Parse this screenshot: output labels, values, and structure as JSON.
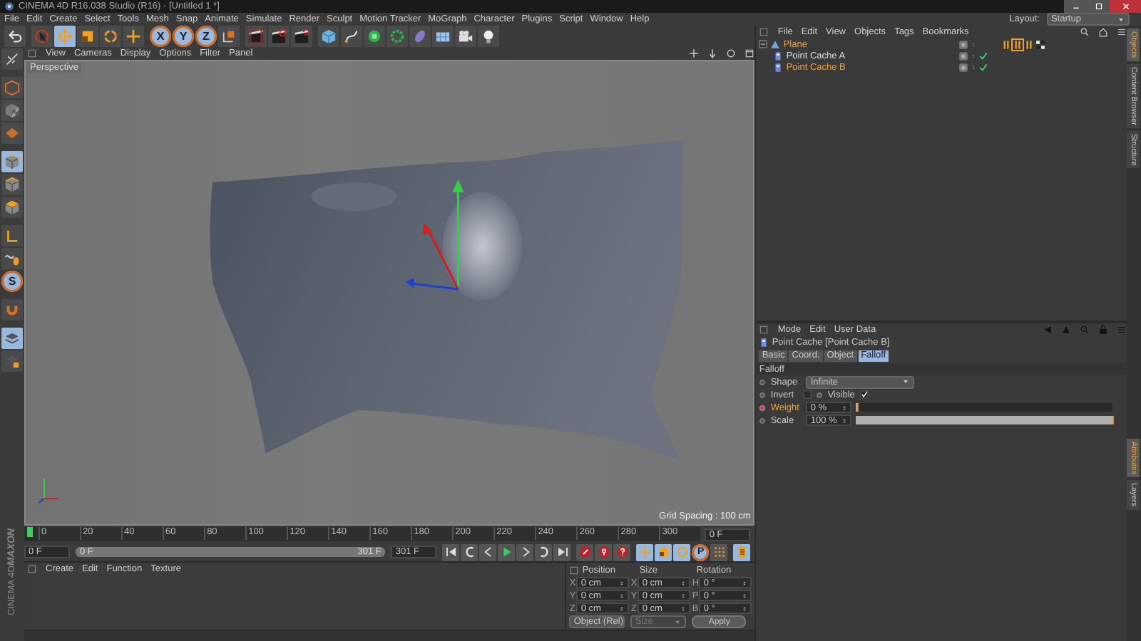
{
  "window": {
    "title": "CINEMA 4D R16.038 Studio (R16) - [Untitled 1 *]"
  },
  "menu": [
    "File",
    "Edit",
    "Create",
    "Select",
    "Tools",
    "Mesh",
    "Snap",
    "Animate",
    "Simulate",
    "Render",
    "Sculpt",
    "Motion Tracker",
    "MoGraph",
    "Character",
    "Plugins",
    "Script",
    "Window",
    "Help"
  ],
  "layout": {
    "label": "Layout:",
    "value": "Startup"
  },
  "toolbar": [
    [
      {
        "kind": "undo",
        "selected": false
      }
    ],
    [
      {
        "kind": "select",
        "selected": false
      },
      {
        "kind": "move",
        "selected": true
      },
      {
        "kind": "scale",
        "selected": false
      },
      {
        "kind": "rotate",
        "selected": false
      },
      {
        "kind": "lasttool",
        "selected": false
      }
    ],
    [
      {
        "kind": "axis",
        "label": "X",
        "selected": true
      },
      {
        "kind": "axis",
        "label": "Y",
        "selected": true
      },
      {
        "kind": "axis",
        "label": "Z",
        "selected": true
      },
      {
        "kind": "coords",
        "selected": false
      }
    ],
    [
      {
        "kind": "renderview",
        "selected": false
      },
      {
        "kind": "render",
        "selected": false
      },
      {
        "kind": "rendersettings",
        "selected": false
      }
    ],
    [
      {
        "kind": "cube",
        "selected": false
      },
      {
        "kind": "pen",
        "selected": false
      },
      {
        "kind": "subdiv",
        "selected": false
      },
      {
        "kind": "array",
        "selected": false
      },
      {
        "kind": "deformer",
        "selected": false
      },
      {
        "kind": "floor",
        "selected": false
      },
      {
        "kind": "camera",
        "selected": false
      },
      {
        "kind": "light",
        "selected": false
      }
    ]
  ],
  "left_toolbar": [
    [
      {
        "kind": "makeeditable",
        "selected": false
      }
    ],
    [
      {
        "kind": "model",
        "selected": false
      },
      {
        "kind": "texture",
        "selected": false
      },
      {
        "kind": "workplane",
        "selected": false
      }
    ],
    [
      {
        "kind": "points",
        "selected": true
      },
      {
        "kind": "edges",
        "selected": false
      },
      {
        "kind": "polygons",
        "selected": false
      }
    ],
    [
      {
        "kind": "axisl",
        "selected": false
      },
      {
        "kind": "tweak",
        "selected": false
      },
      {
        "kind": "snap",
        "label": "S",
        "selected": true
      }
    ],
    [
      {
        "kind": "magnet",
        "selected": false
      }
    ],
    [
      {
        "kind": "layers",
        "selected": true
      },
      {
        "kind": "lock",
        "selected": false
      }
    ]
  ],
  "logo": {
    "brand": "MAXON",
    "product": "CINEMA 4D"
  },
  "viewport": {
    "menu": [
      "View",
      "Cameras",
      "Display",
      "Options",
      "Filter",
      "Panel"
    ],
    "camera": "Perspective",
    "grid_spacing": "Grid Spacing : 100 cm"
  },
  "timeline": {
    "ticks": [
      "0",
      "20",
      "40",
      "60",
      "80",
      "100",
      "120",
      "140",
      "160",
      "180",
      "200",
      "220",
      "240",
      "260",
      "280",
      "300"
    ],
    "level": 0,
    "frame_field": "0 F",
    "start_field": "0 F",
    "range": {
      "start": "0 F",
      "end": "301 F",
      "level": 1
    },
    "end_field": "301 F",
    "playback": [
      {
        "kind": "first"
      },
      {
        "kind": "prevkey"
      },
      {
        "kind": "prevframe"
      },
      {
        "kind": "play"
      },
      {
        "kind": "nextframe"
      },
      {
        "kind": "nextkey"
      },
      {
        "kind": "last"
      }
    ],
    "record": [
      {
        "kind": "record"
      },
      {
        "kind": "autokey"
      },
      {
        "kind": "keyselection"
      }
    ],
    "key_modes": [
      {
        "kind": "keypos",
        "selected": true
      },
      {
        "kind": "keyscale",
        "selected": true
      },
      {
        "kind": "keyrot",
        "selected": true
      },
      {
        "kind": "keyparam",
        "label": "P",
        "selected": true
      },
      {
        "kind": "keypla",
        "selected": false
      }
    ],
    "dopesheet": {
      "selected": true
    }
  },
  "materials": {
    "menu": [
      "Create",
      "Edit",
      "Function",
      "Texture"
    ]
  },
  "coordinates": {
    "headers": [
      "Position",
      "Size",
      "Rotation"
    ],
    "rows": [
      {
        "axis": "X",
        "position": "0 cm",
        "size_axis": "X",
        "size": "0 cm",
        "rotation_axis": "H",
        "rotation": "0 °"
      },
      {
        "axis": "Y",
        "position": "0 cm",
        "size_axis": "Y",
        "size": "0 cm",
        "rotation_axis": "P",
        "rotation": "0 °"
      },
      {
        "axis": "Z",
        "position": "0 cm",
        "size_axis": "Z",
        "size": "0 cm",
        "rotation_axis": "B",
        "rotation": "0 °"
      }
    ],
    "mode": "Object (Rel)",
    "size_mode": {
      "value": "Size",
      "disabled": true
    },
    "apply": "Apply"
  },
  "objects": {
    "menu": [
      "File",
      "Edit",
      "View",
      "Objects",
      "Tags",
      "Bookmarks"
    ],
    "items": [
      {
        "name": "Plane",
        "selected": true,
        "check": false,
        "tags": [
          {
            "selected": false
          },
          {
            "selected": true
          },
          {
            "selected": false
          },
          {
            "selected": false
          }
        ],
        "children": [
          {
            "name": "Point Cache A",
            "selected": false,
            "check": true
          },
          {
            "name": "Point Cache B",
            "selected": true,
            "check": true
          }
        ]
      }
    ]
  },
  "attributes": {
    "menu": [
      "Mode",
      "Edit",
      "User Data"
    ],
    "title": "Point Cache [Point Cache B]",
    "tabs": [
      {
        "label": "Basic",
        "selected": false
      },
      {
        "label": "Coord.",
        "selected": false
      },
      {
        "label": "Object",
        "selected": false
      },
      {
        "label": "Falloff",
        "selected": true
      }
    ],
    "section": "Falloff",
    "rows": [
      {
        "kind": "dropdown",
        "label": "Shape",
        "value": "Infinite",
        "keyframed": false
      },
      {
        "kind": "checks",
        "items": [
          {
            "label": "Invert",
            "checked": false
          },
          {
            "label": "Visible",
            "checked": true
          }
        ]
      },
      {
        "kind": "slider",
        "label": "Weight",
        "value": "0 %",
        "level": 0,
        "keyframed": true
      },
      {
        "kind": "slider",
        "label": "Scale",
        "value": "100 %",
        "level": 1,
        "keyframed": false
      }
    ]
  },
  "side_tabs": {
    "top": [
      {
        "label": "Objects",
        "selected": true
      },
      {
        "label": "Content Browser",
        "selected": false
      },
      {
        "label": "Structure",
        "selected": false
      }
    ],
    "bottom": [
      {
        "label": "Attributes",
        "selected": true
      },
      {
        "label": "Layers",
        "selected": false
      }
    ]
  }
}
